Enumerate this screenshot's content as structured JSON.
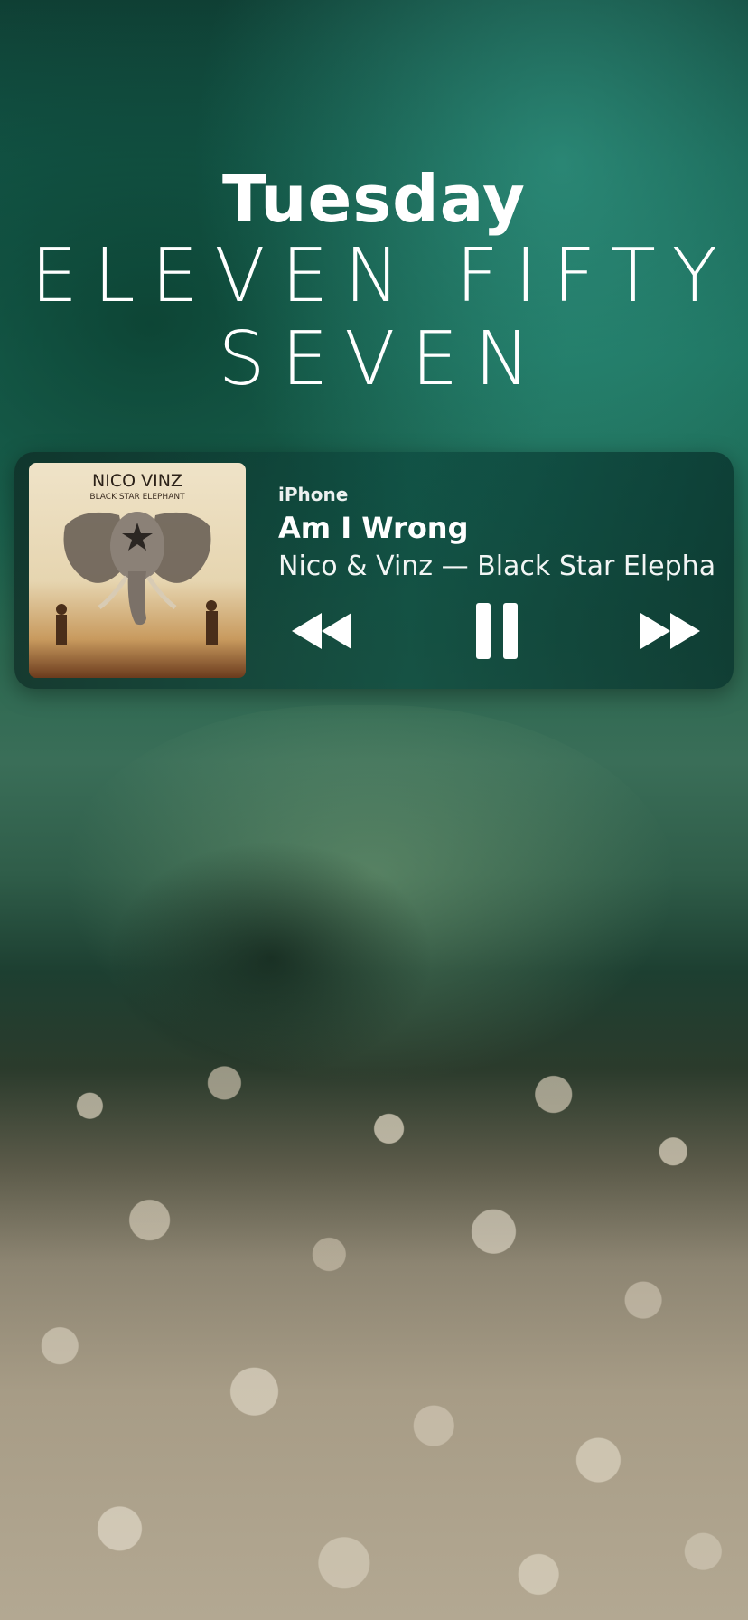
{
  "lock_screen": {
    "day": "Tuesday",
    "time_line1": "ELEVEN FIFTY",
    "time_line2": "SEVEN"
  },
  "now_playing": {
    "source": "iPhone",
    "title": "Am I Wrong",
    "subtitle": "Nico & Vinz — Black Star Elephant",
    "album_art_text": {
      "artist": "NICO VINZ",
      "album": "BLACK STAR ELEPHANT"
    },
    "state": "playing",
    "controls": {
      "rewind_icon": "rewind-icon",
      "pause_icon": "pause-icon",
      "forward_icon": "fast-forward-icon"
    }
  },
  "colors": {
    "text": "#ffffff",
    "panel": "#0c4a3e"
  }
}
